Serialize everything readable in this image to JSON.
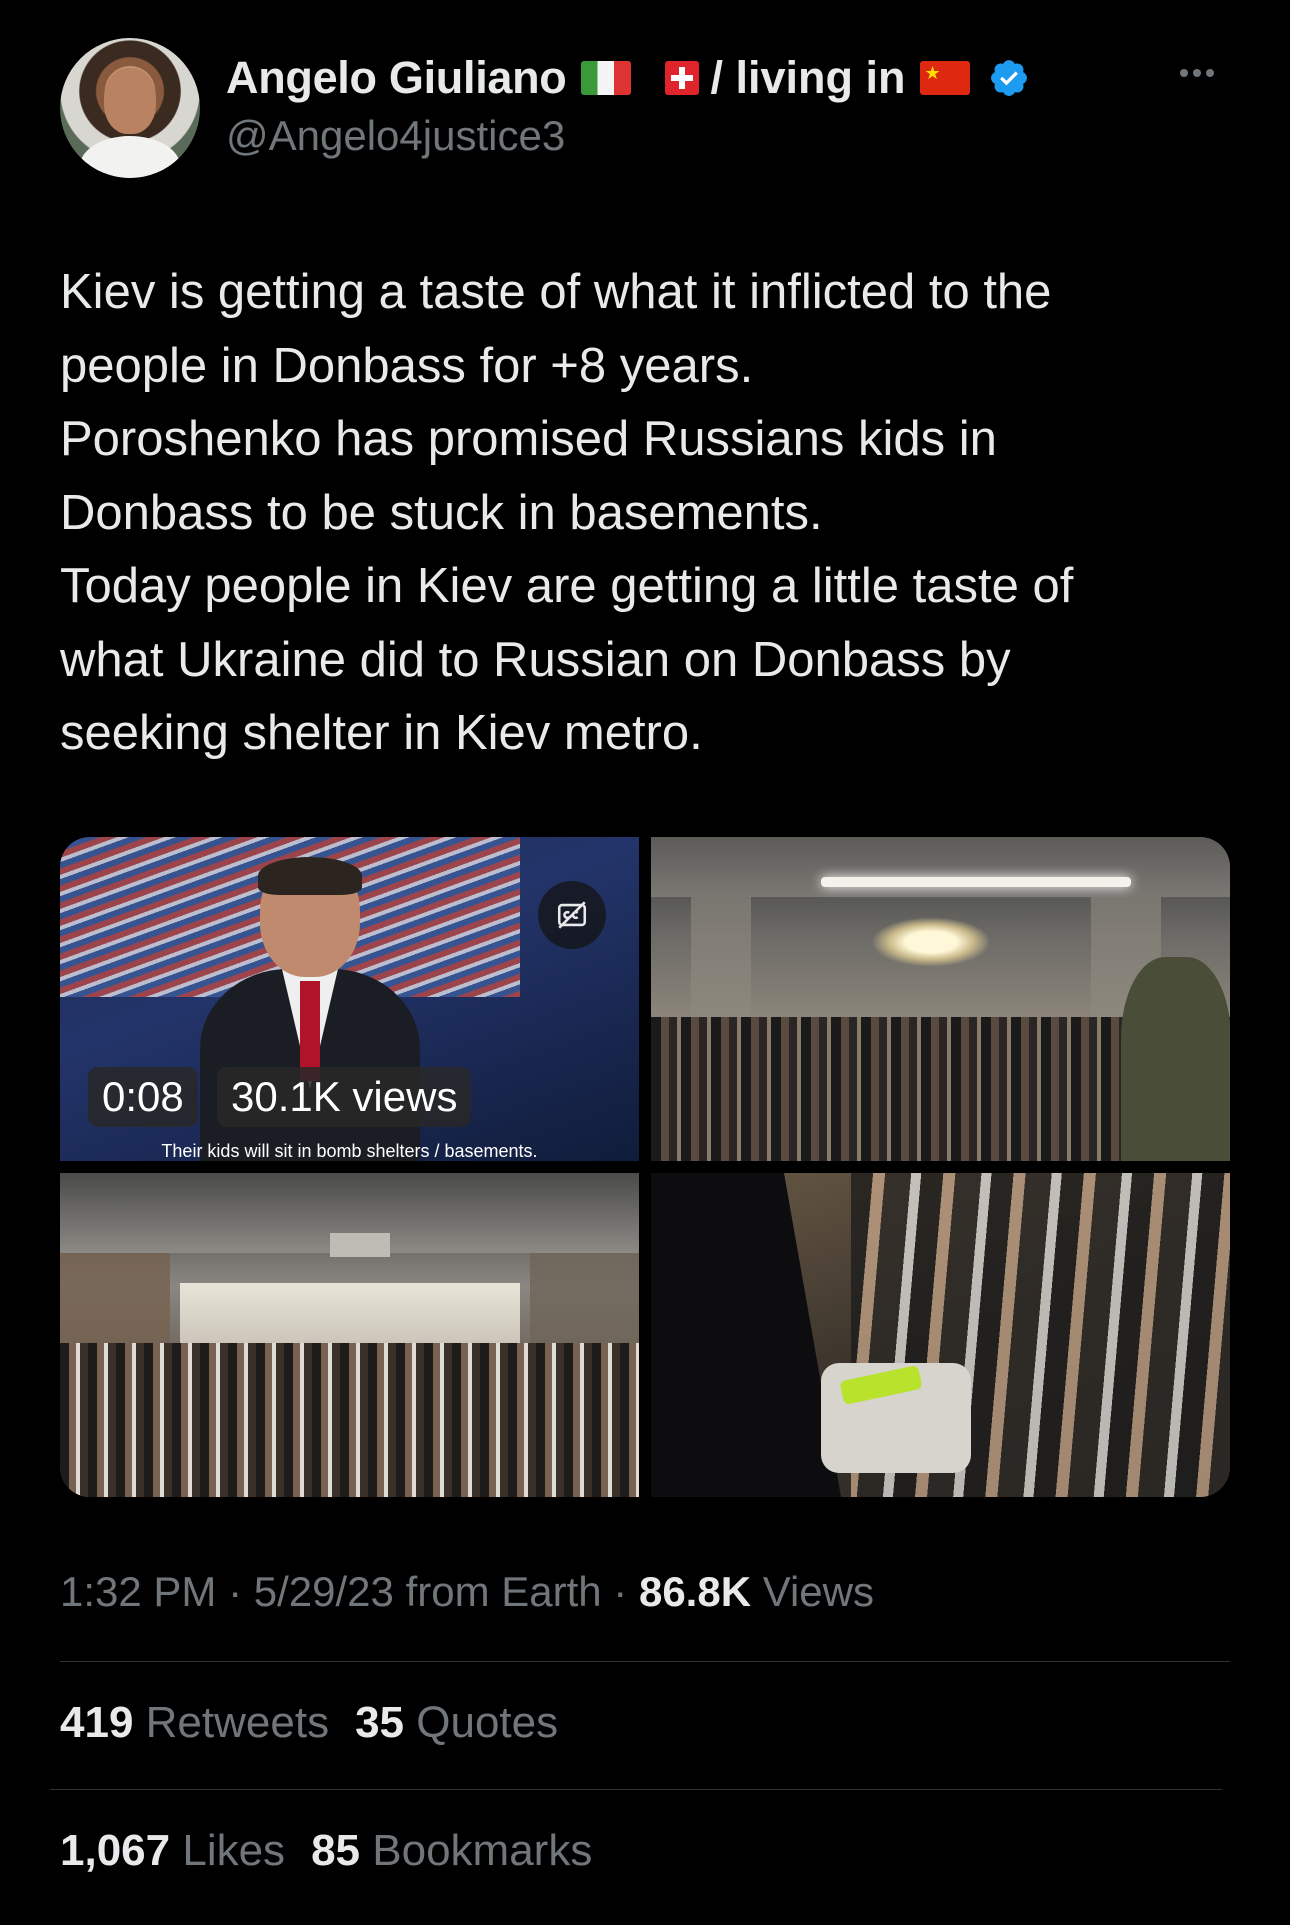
{
  "author": {
    "name": "Angelo Giuliano",
    "flags": [
      "italy-flag",
      "switzerland-flag",
      "china-flag"
    ],
    "location_text": "/ living in",
    "handle": "@Angelo4justice3",
    "verified": true,
    "verified_color": "#1d9bf0"
  },
  "tweet": {
    "lines": [
      "Kiev is getting a taste of what it inflicted to the",
      "people in Donbass for +8 years.",
      "Poroshenko has promised Russians kids in",
      "Donbass to be stuck in basements.",
      "Today people in Kiev are getting a little taste of",
      "what Ukraine did to Russian on Donbass by",
      "seeking shelter in Kiev metro."
    ]
  },
  "media": {
    "video": {
      "duration": "0:08",
      "views": "30.1K views",
      "subtitle": "Their kids will sit in bomb shelters / basements."
    }
  },
  "meta": {
    "time": "1:32 PM",
    "date": "5/29/23 from Earth",
    "separator": "·",
    "views_count": "86.8K",
    "views_label": "Views"
  },
  "stats": {
    "retweets_count": "419",
    "retweets_label": "Retweets",
    "quotes_count": "35",
    "quotes_label": "Quotes",
    "likes_count": "1,067",
    "likes_label": "Likes",
    "bookmarks_count": "85",
    "bookmarks_label": "Bookmarks"
  }
}
